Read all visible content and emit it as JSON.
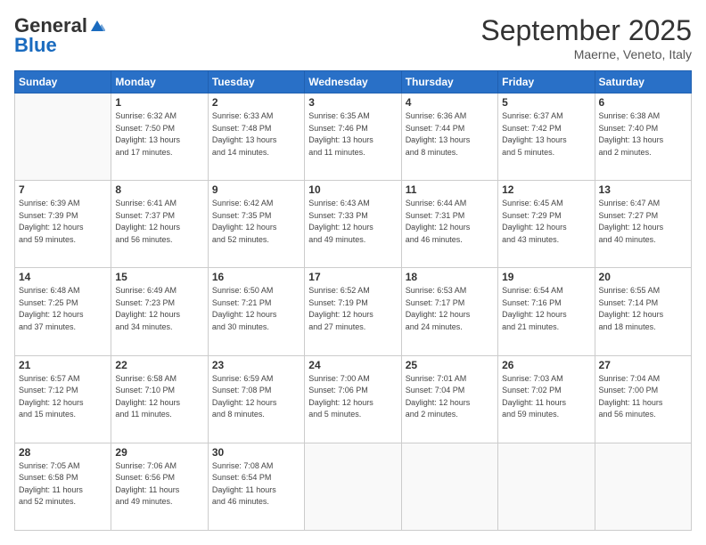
{
  "header": {
    "logo_general": "General",
    "logo_blue": "Blue",
    "month": "September 2025",
    "location": "Maerne, Veneto, Italy"
  },
  "days_of_week": [
    "Sunday",
    "Monday",
    "Tuesday",
    "Wednesday",
    "Thursday",
    "Friday",
    "Saturday"
  ],
  "weeks": [
    [
      {
        "day": "",
        "info": ""
      },
      {
        "day": "1",
        "info": "Sunrise: 6:32 AM\nSunset: 7:50 PM\nDaylight: 13 hours\nand 17 minutes."
      },
      {
        "day": "2",
        "info": "Sunrise: 6:33 AM\nSunset: 7:48 PM\nDaylight: 13 hours\nand 14 minutes."
      },
      {
        "day": "3",
        "info": "Sunrise: 6:35 AM\nSunset: 7:46 PM\nDaylight: 13 hours\nand 11 minutes."
      },
      {
        "day": "4",
        "info": "Sunrise: 6:36 AM\nSunset: 7:44 PM\nDaylight: 13 hours\nand 8 minutes."
      },
      {
        "day": "5",
        "info": "Sunrise: 6:37 AM\nSunset: 7:42 PM\nDaylight: 13 hours\nand 5 minutes."
      },
      {
        "day": "6",
        "info": "Sunrise: 6:38 AM\nSunset: 7:40 PM\nDaylight: 13 hours\nand 2 minutes."
      }
    ],
    [
      {
        "day": "7",
        "info": "Sunrise: 6:39 AM\nSunset: 7:39 PM\nDaylight: 12 hours\nand 59 minutes."
      },
      {
        "day": "8",
        "info": "Sunrise: 6:41 AM\nSunset: 7:37 PM\nDaylight: 12 hours\nand 56 minutes."
      },
      {
        "day": "9",
        "info": "Sunrise: 6:42 AM\nSunset: 7:35 PM\nDaylight: 12 hours\nand 52 minutes."
      },
      {
        "day": "10",
        "info": "Sunrise: 6:43 AM\nSunset: 7:33 PM\nDaylight: 12 hours\nand 49 minutes."
      },
      {
        "day": "11",
        "info": "Sunrise: 6:44 AM\nSunset: 7:31 PM\nDaylight: 12 hours\nand 46 minutes."
      },
      {
        "day": "12",
        "info": "Sunrise: 6:45 AM\nSunset: 7:29 PM\nDaylight: 12 hours\nand 43 minutes."
      },
      {
        "day": "13",
        "info": "Sunrise: 6:47 AM\nSunset: 7:27 PM\nDaylight: 12 hours\nand 40 minutes."
      }
    ],
    [
      {
        "day": "14",
        "info": "Sunrise: 6:48 AM\nSunset: 7:25 PM\nDaylight: 12 hours\nand 37 minutes."
      },
      {
        "day": "15",
        "info": "Sunrise: 6:49 AM\nSunset: 7:23 PM\nDaylight: 12 hours\nand 34 minutes."
      },
      {
        "day": "16",
        "info": "Sunrise: 6:50 AM\nSunset: 7:21 PM\nDaylight: 12 hours\nand 30 minutes."
      },
      {
        "day": "17",
        "info": "Sunrise: 6:52 AM\nSunset: 7:19 PM\nDaylight: 12 hours\nand 27 minutes."
      },
      {
        "day": "18",
        "info": "Sunrise: 6:53 AM\nSunset: 7:17 PM\nDaylight: 12 hours\nand 24 minutes."
      },
      {
        "day": "19",
        "info": "Sunrise: 6:54 AM\nSunset: 7:16 PM\nDaylight: 12 hours\nand 21 minutes."
      },
      {
        "day": "20",
        "info": "Sunrise: 6:55 AM\nSunset: 7:14 PM\nDaylight: 12 hours\nand 18 minutes."
      }
    ],
    [
      {
        "day": "21",
        "info": "Sunrise: 6:57 AM\nSunset: 7:12 PM\nDaylight: 12 hours\nand 15 minutes."
      },
      {
        "day": "22",
        "info": "Sunrise: 6:58 AM\nSunset: 7:10 PM\nDaylight: 12 hours\nand 11 minutes."
      },
      {
        "day": "23",
        "info": "Sunrise: 6:59 AM\nSunset: 7:08 PM\nDaylight: 12 hours\nand 8 minutes."
      },
      {
        "day": "24",
        "info": "Sunrise: 7:00 AM\nSunset: 7:06 PM\nDaylight: 12 hours\nand 5 minutes."
      },
      {
        "day": "25",
        "info": "Sunrise: 7:01 AM\nSunset: 7:04 PM\nDaylight: 12 hours\nand 2 minutes."
      },
      {
        "day": "26",
        "info": "Sunrise: 7:03 AM\nSunset: 7:02 PM\nDaylight: 11 hours\nand 59 minutes."
      },
      {
        "day": "27",
        "info": "Sunrise: 7:04 AM\nSunset: 7:00 PM\nDaylight: 11 hours\nand 56 minutes."
      }
    ],
    [
      {
        "day": "28",
        "info": "Sunrise: 7:05 AM\nSunset: 6:58 PM\nDaylight: 11 hours\nand 52 minutes."
      },
      {
        "day": "29",
        "info": "Sunrise: 7:06 AM\nSunset: 6:56 PM\nDaylight: 11 hours\nand 49 minutes."
      },
      {
        "day": "30",
        "info": "Sunrise: 7:08 AM\nSunset: 6:54 PM\nDaylight: 11 hours\nand 46 minutes."
      },
      {
        "day": "",
        "info": ""
      },
      {
        "day": "",
        "info": ""
      },
      {
        "day": "",
        "info": ""
      },
      {
        "day": "",
        "info": ""
      }
    ]
  ]
}
